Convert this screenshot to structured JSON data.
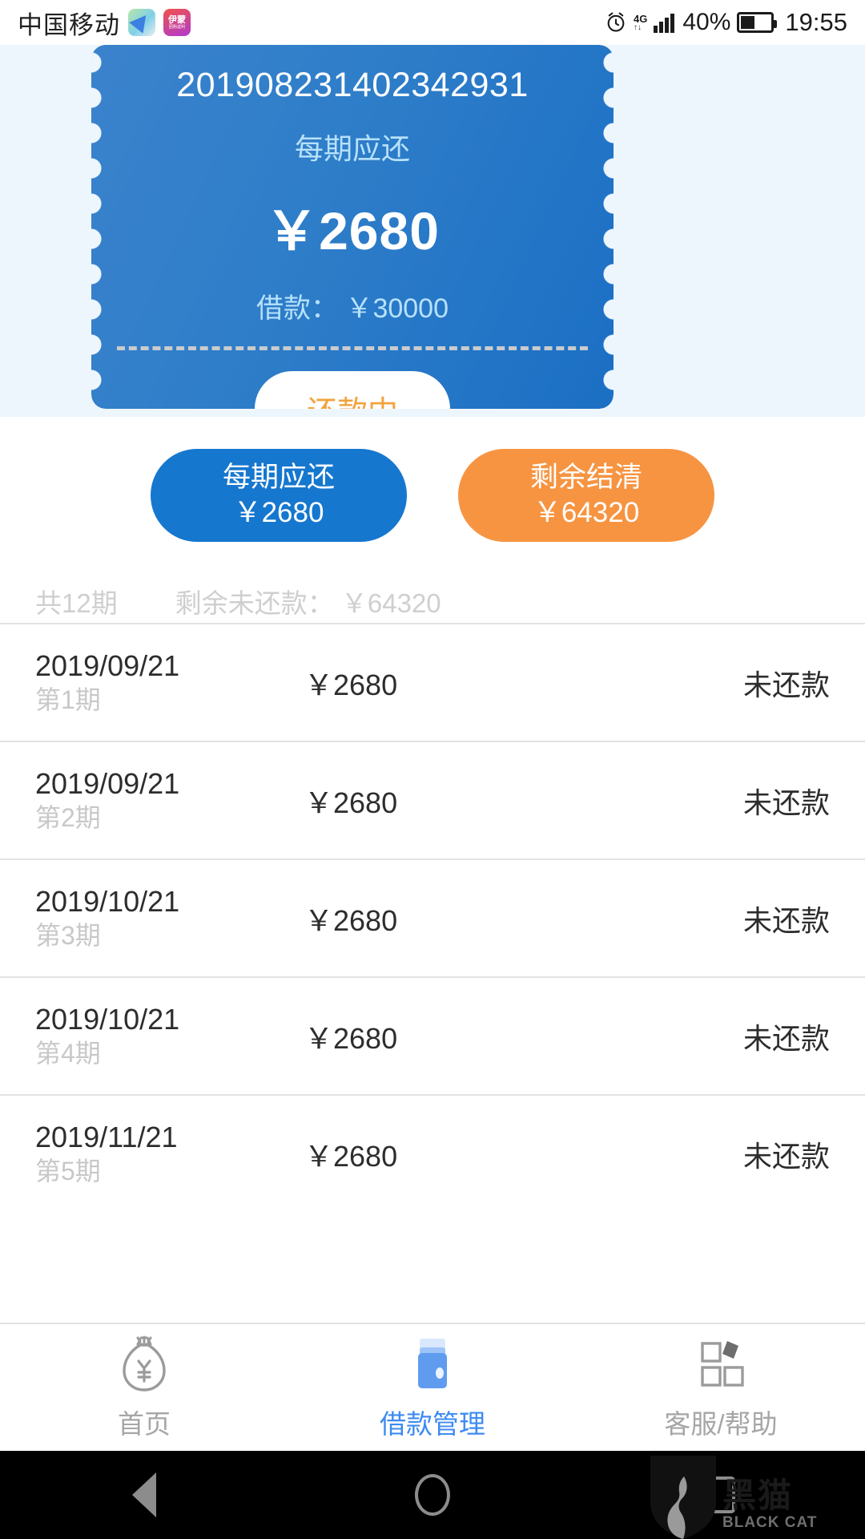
{
  "statusbar": {
    "carrier": "中国移动",
    "app_icon_1": "map-app-icon",
    "app_icon_2_top": "伊蒙",
    "app_icon_2_bottom": "团购返利",
    "alarm_icon": "alarm-clock-icon",
    "network": "4G",
    "battery_percent": "40%",
    "time": "19:55"
  },
  "ticket": {
    "order_number": "201908231402342931",
    "per_period_label": "每期应还",
    "per_period_amount": "￥2680",
    "loan_line": "借款： ￥30000",
    "status_button": "还款中",
    "status_color": "#f2a33d",
    "card_color": "#1b6fc4"
  },
  "actions": [
    {
      "label": "每期应还",
      "value": "￥2680",
      "color": "#1677cf"
    },
    {
      "label": "剩余结清",
      "value": "￥64320",
      "color": "#f79441"
    }
  ],
  "summary": {
    "periods": "共12期",
    "remaining": "剩余未还款： ￥64320"
  },
  "installments": [
    {
      "date": "2019/09/21",
      "period": "第1期",
      "amount": "￥2680",
      "status": "未还款"
    },
    {
      "date": "2019/09/21",
      "period": "第2期",
      "amount": "￥2680",
      "status": "未还款"
    },
    {
      "date": "2019/10/21",
      "period": "第3期",
      "amount": "￥2680",
      "status": "未还款"
    },
    {
      "date": "2019/10/21",
      "period": "第4期",
      "amount": "￥2680",
      "status": "未还款"
    },
    {
      "date": "2019/11/21",
      "period": "第5期",
      "amount": "￥2680",
      "status": "未还款"
    }
  ],
  "tabbar": [
    {
      "label": "首页",
      "icon": "money-bag-icon",
      "active": false
    },
    {
      "label": "借款管理",
      "icon": "wallet-icon",
      "active": true
    },
    {
      "label": "客服/帮助",
      "icon": "grid-squares-icon",
      "active": false
    }
  ],
  "navbar": {
    "back": "back-triangle-icon",
    "home": "home-circle-icon",
    "recents": "recents-square-icon"
  },
  "watermark": {
    "cn": "黑猫",
    "en": "BLACK CAT"
  }
}
